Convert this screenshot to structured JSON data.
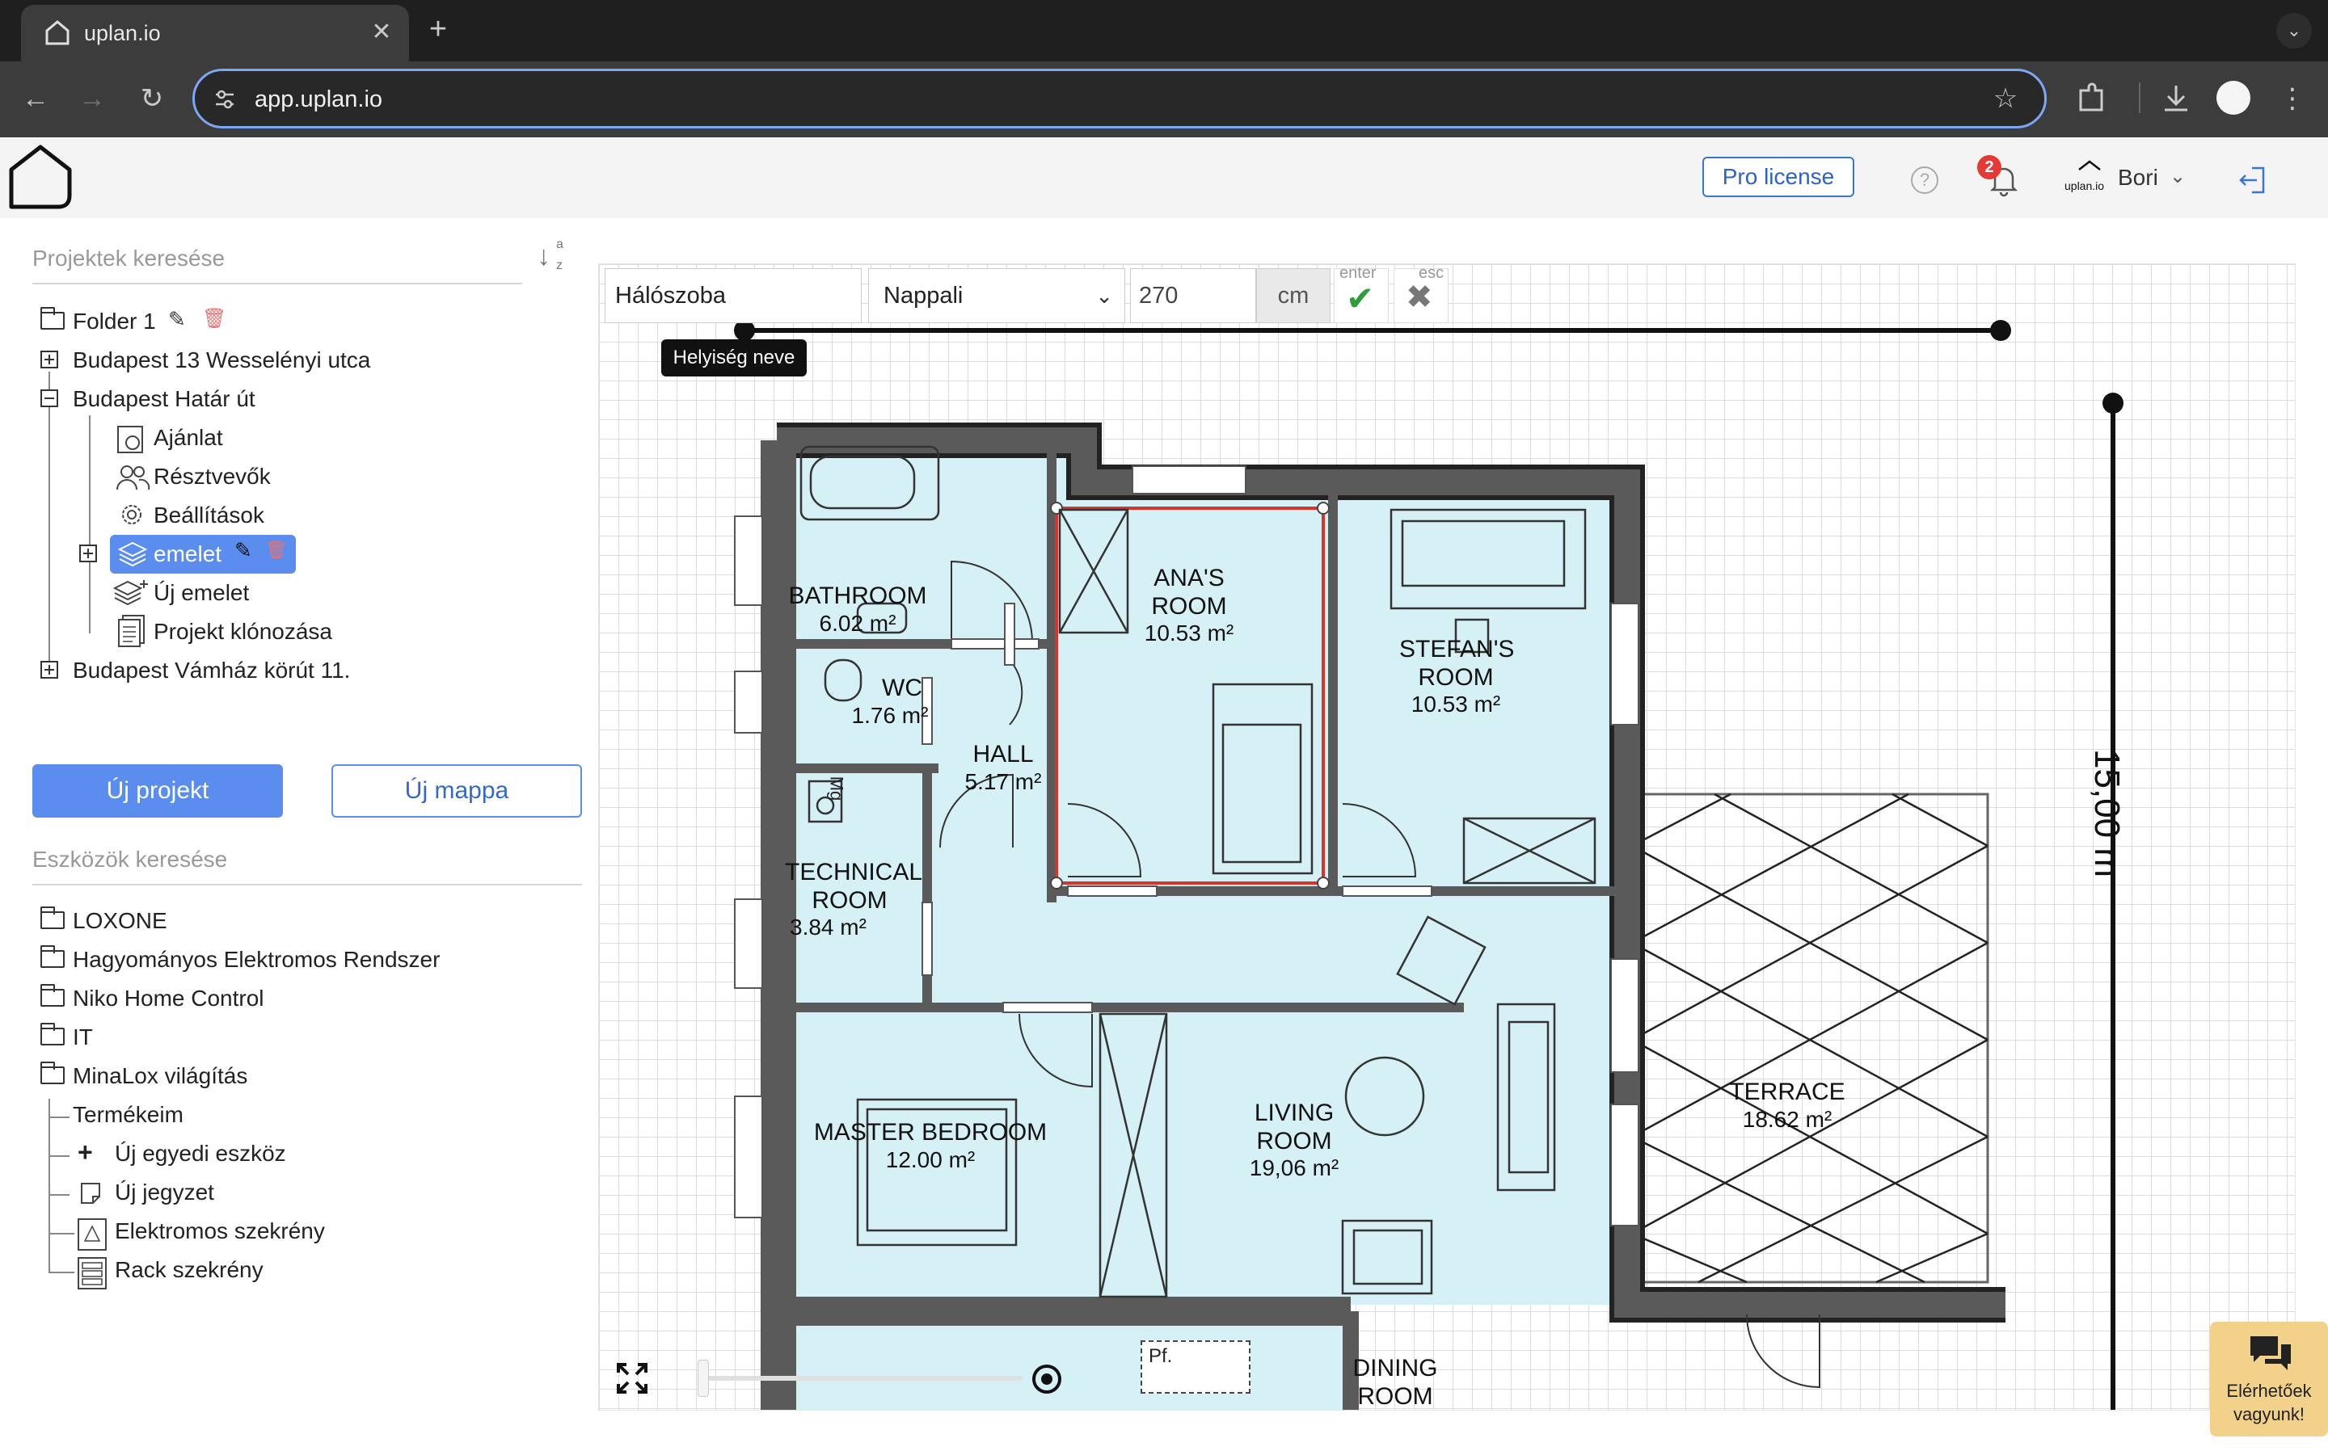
{
  "browser": {
    "tab_title": "uplan.io",
    "url": "app.uplan.io"
  },
  "header": {
    "pro_license": "Pro license",
    "notification_count": "2",
    "logo_text": "uplan.io",
    "user_name": "Bori"
  },
  "sidebar": {
    "project_search_placeholder": "Projektek keresése",
    "sort_label_a": "a",
    "sort_label_z": "z",
    "tree": {
      "folder1": "Folder 1",
      "p1": "Budapest 13 Wesselényi utca",
      "p2": "Budapest Határ út",
      "offer": "Ajánlat",
      "participants": "Résztvevők",
      "settings": "Beállítások",
      "floor": "emelet",
      "new_floor": "Új emelet",
      "clone": "Projekt klónozása",
      "p3": "Budapest Vámház körút 11."
    },
    "new_project": "Új projekt",
    "new_folder": "Új mappa",
    "tool_search_placeholder": "Eszközök keresése",
    "tools": {
      "loxone": "LOXONE",
      "traditional": "Hagyományos Elektromos Rendszer",
      "niko": "Niko Home Control",
      "it": "IT",
      "minalox": "MinaLox világítás",
      "my_products": "Termékeim",
      "new_device": "Új egyedi eszköz",
      "new_note": "Új jegyzet",
      "cabinet": "Elektromos szekrény",
      "rack": "Rack szekrény"
    }
  },
  "toolbar": {
    "room_name": "Hálószoba",
    "room_type": "Nappali",
    "height_value": "270",
    "unit": "cm",
    "hint_enter": "enter",
    "hint_esc": "esc",
    "tooltip": "Helyiség neve"
  },
  "floorplan": {
    "dimension": "15,00 m",
    "rooms": [
      {
        "name": "BATHROOM",
        "area": "6.02 m²"
      },
      {
        "name": "ANA'S ROOM",
        "area": "10.53 m²"
      },
      {
        "name": "STEFAN'S ROOM",
        "area": "10.53 m²"
      },
      {
        "name": "WC",
        "area": "1.76 m²"
      },
      {
        "name": "HALL",
        "area": "5.17 m²"
      },
      {
        "name": "TECHNICAL ROOM",
        "area": "3.84 m²"
      },
      {
        "name": "TERRACE",
        "area": "18.62 m²"
      },
      {
        "name": "MASTER BEDROOM",
        "area": "12.00 m²"
      },
      {
        "name": "LIVING ROOM",
        "area": "19,06 m²"
      },
      {
        "name": "DINING ROOM",
        "area": ""
      }
    ],
    "appliance_label": "Mg",
    "pf_label": "Pf."
  },
  "chat": {
    "line1": "Elérhetőek",
    "line2": "vagyunk!"
  },
  "colors": {
    "accent": "#5b8dee",
    "room_fill": "#d6f1f6",
    "wall": "#5a5a5a",
    "selection": "#d9342b"
  }
}
